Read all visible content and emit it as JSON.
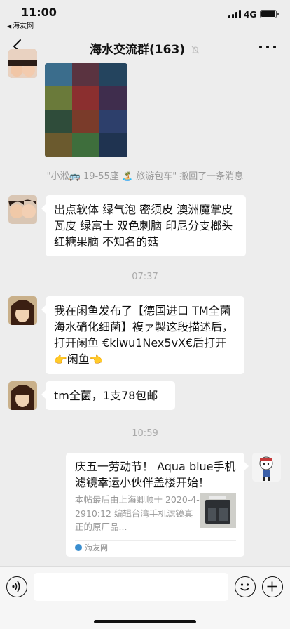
{
  "status_bar": {
    "time": "11:00",
    "back_app": "海友网",
    "network": "4G",
    "battery_level": 1.0
  },
  "nav": {
    "title": "海水交流群(163)",
    "back_icon": "chevron-left-icon",
    "mute_icon": "bell-off-icon",
    "more_icon": "more-dots-icon"
  },
  "messages": {
    "recall_notice": "\"小淞🚌 19-55座 🏝️ 旅游包车\" 撤回了一条消息",
    "msg1_text": "出点软体 绿气泡 密须皮 澳洲魔掌皮 瓦皮 绿富士 双色刺脑 印尼分支榔头 红糖果脑 不知名的菇",
    "time1": "07:37",
    "msg2_text_a": "我在闲鱼发布了【德国进口 TM全菌海水硝化细菌】複ァ製这段描述后，打开闲鱼 €kiwu1Nex5vX€后打开",
    "msg2_emoji_a": "👉",
    "msg2_text_b": "闲鱼",
    "msg2_emoji_b": "👈",
    "msg3_text": "tm全菌，1支78包邮",
    "time2": "10:59"
  },
  "link_card": {
    "title": "庆五一劳动节！ Aqua blue手机滤镜幸运小伙伴盖楼开始！",
    "description": "本帖最后由上海卿顺于 2020-4-2910:12 编辑台湾手机滤镜真正的原厂品...",
    "source": "海友网"
  },
  "input_bar": {
    "voice_icon": "voice-icon",
    "emoji_icon": "smile-icon",
    "plus_icon": "plus-icon"
  }
}
